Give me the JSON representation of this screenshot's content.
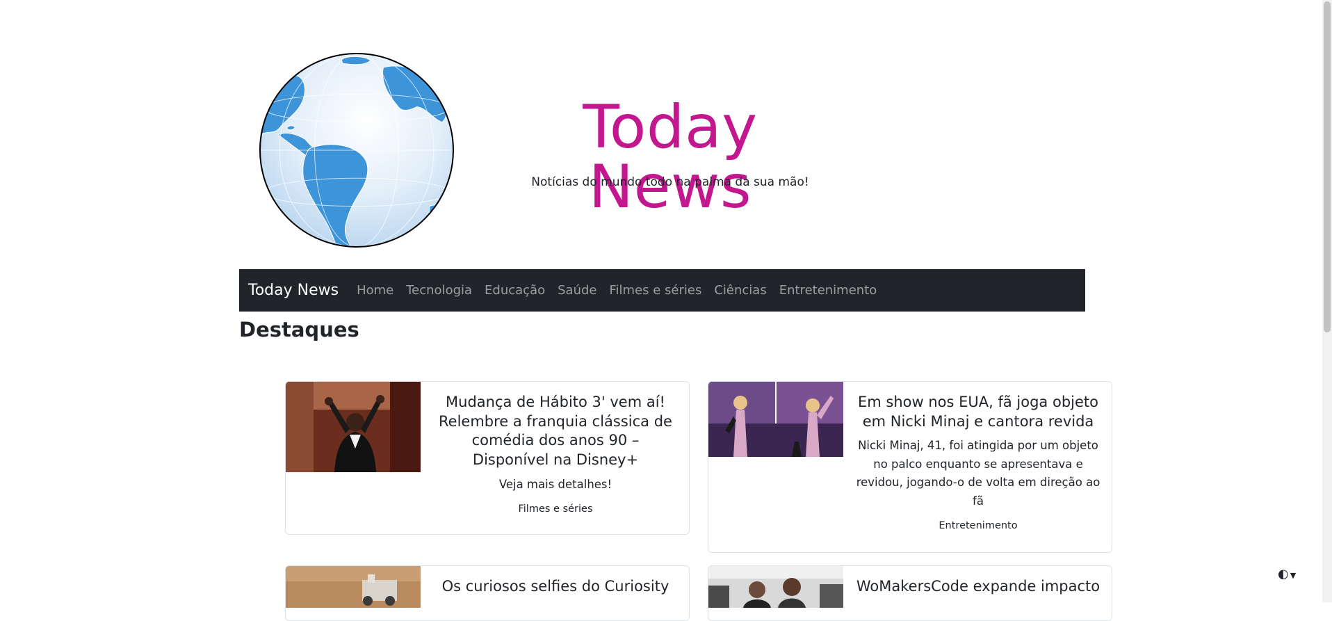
{
  "header": {
    "title": "Today News",
    "tagline": "Notícias do mundo todo na palma da sua mão!"
  },
  "navbar": {
    "brand": "Today News",
    "items": [
      "Home",
      "Tecnologia",
      "Educação",
      "Saúde",
      "Filmes e séries",
      "Ciências",
      "Entretenimento"
    ]
  },
  "section": {
    "title": "Destaques"
  },
  "cards": [
    {
      "title": "Mudança de Hábito 3' vem aí! Relembre a franquia clássica de comédia dos anos 90 – Disponível na Disney+",
      "description": "Veja mais detalhes!",
      "category": "Filmes e séries"
    },
    {
      "title": "Em show nos EUA, fã joga objeto em Nicki Minaj e cantora revida",
      "description": "Nicki Minaj, 41, foi atingida por um objeto no palco enquanto se apresentava e revidou, jogando-o de volta em direção ao fã",
      "category": "Entretenimento"
    },
    {
      "title": "Os curiosos selfies do Curiosity",
      "description": "",
      "category": ""
    },
    {
      "title": "WoMakersCode expande impacto",
      "description": "",
      "category": ""
    }
  ],
  "theme_toggle": {
    "icon": "contrast-icon"
  },
  "colors": {
    "brand": "#c2178e",
    "navbar": "#212529",
    "globe_land": "#3d94d9"
  }
}
